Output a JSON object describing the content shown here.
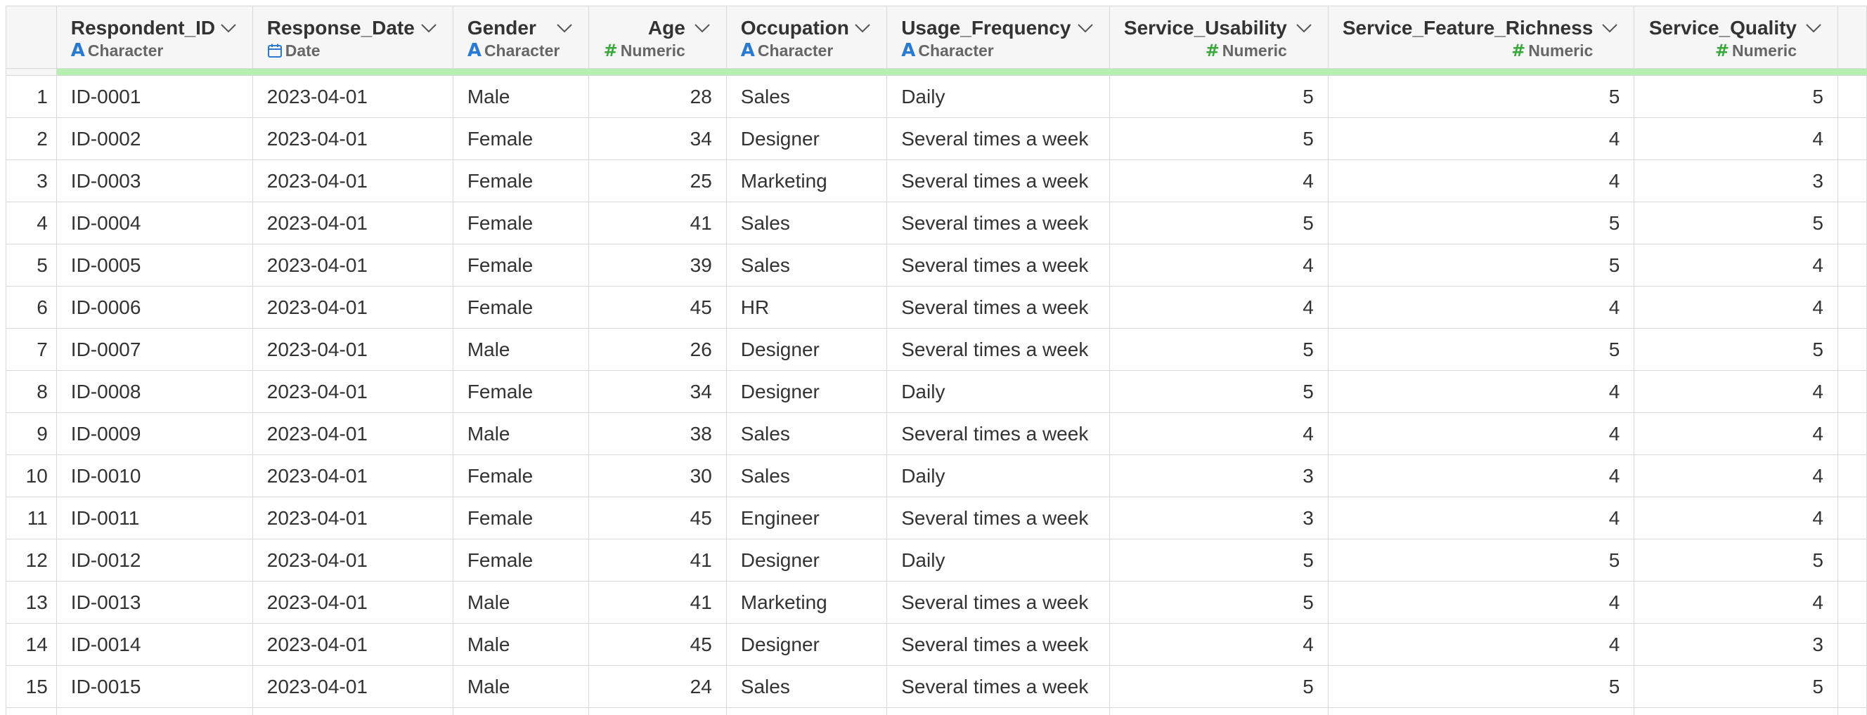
{
  "columns": [
    {
      "name": "Respondent_ID",
      "type": "Character",
      "type_icon": "character-icon",
      "align": "left"
    },
    {
      "name": "Response_Date",
      "type": "Date",
      "type_icon": "calendar-icon",
      "align": "left"
    },
    {
      "name": "Gender",
      "type": "Character",
      "type_icon": "character-icon",
      "align": "left"
    },
    {
      "name": "Age",
      "type": "Numeric",
      "type_icon": "numeric-icon",
      "align": "right"
    },
    {
      "name": "Occupation",
      "type": "Character",
      "type_icon": "character-icon",
      "align": "left"
    },
    {
      "name": "Usage_Frequency",
      "type": "Character",
      "type_icon": "character-icon",
      "align": "left"
    },
    {
      "name": "Service_Usability",
      "type": "Numeric",
      "type_icon": "numeric-icon",
      "align": "right"
    },
    {
      "name": "Service_Feature_Richness",
      "type": "Numeric",
      "type_icon": "numeric-icon",
      "align": "right"
    },
    {
      "name": "Service_Quality",
      "type": "Numeric",
      "type_icon": "numeric-icon",
      "align": "right"
    }
  ],
  "colors": {
    "character_icon": "#2a7ad2",
    "numeric_icon": "#39a83a",
    "date_icon": "#2a7ad2",
    "header_accent": "#b6f0b0",
    "header_bg": "#f6f6f6",
    "grid_line": "#d9d9d9"
  },
  "rows": [
    {
      "n": "1",
      "cells": [
        "ID-0001",
        "2023-04-01",
        "Male",
        "28",
        "Sales",
        "Daily",
        "5",
        "5",
        "5"
      ]
    },
    {
      "n": "2",
      "cells": [
        "ID-0002",
        "2023-04-01",
        "Female",
        "34",
        "Designer",
        "Several times a week",
        "5",
        "4",
        "4"
      ]
    },
    {
      "n": "3",
      "cells": [
        "ID-0003",
        "2023-04-01",
        "Female",
        "25",
        "Marketing",
        "Several times a week",
        "4",
        "4",
        "3"
      ]
    },
    {
      "n": "4",
      "cells": [
        "ID-0004",
        "2023-04-01",
        "Female",
        "41",
        "Sales",
        "Several times a week",
        "5",
        "5",
        "5"
      ]
    },
    {
      "n": "5",
      "cells": [
        "ID-0005",
        "2023-04-01",
        "Female",
        "39",
        "Sales",
        "Several times a week",
        "4",
        "5",
        "4"
      ]
    },
    {
      "n": "6",
      "cells": [
        "ID-0006",
        "2023-04-01",
        "Female",
        "45",
        "HR",
        "Several times a week",
        "4",
        "4",
        "4"
      ]
    },
    {
      "n": "7",
      "cells": [
        "ID-0007",
        "2023-04-01",
        "Male",
        "26",
        "Designer",
        "Several times a week",
        "5",
        "5",
        "5"
      ]
    },
    {
      "n": "8",
      "cells": [
        "ID-0008",
        "2023-04-01",
        "Female",
        "34",
        "Designer",
        "Daily",
        "5",
        "4",
        "4"
      ]
    },
    {
      "n": "9",
      "cells": [
        "ID-0009",
        "2023-04-01",
        "Male",
        "38",
        "Sales",
        "Several times a week",
        "4",
        "4",
        "4"
      ]
    },
    {
      "n": "10",
      "cells": [
        "ID-0010",
        "2023-04-01",
        "Female",
        "30",
        "Sales",
        "Daily",
        "3",
        "4",
        "4"
      ]
    },
    {
      "n": "11",
      "cells": [
        "ID-0011",
        "2023-04-01",
        "Female",
        "45",
        "Engineer",
        "Several times a week",
        "3",
        "4",
        "4"
      ]
    },
    {
      "n": "12",
      "cells": [
        "ID-0012",
        "2023-04-01",
        "Female",
        "41",
        "Designer",
        "Daily",
        "5",
        "5",
        "5"
      ]
    },
    {
      "n": "13",
      "cells": [
        "ID-0013",
        "2023-04-01",
        "Male",
        "41",
        "Marketing",
        "Several times a week",
        "5",
        "4",
        "4"
      ]
    },
    {
      "n": "14",
      "cells": [
        "ID-0014",
        "2023-04-01",
        "Male",
        "45",
        "Designer",
        "Several times a week",
        "4",
        "4",
        "3"
      ]
    },
    {
      "n": "15",
      "cells": [
        "ID-0015",
        "2023-04-01",
        "Male",
        "24",
        "Sales",
        "Several times a week",
        "5",
        "5",
        "5"
      ]
    }
  ]
}
